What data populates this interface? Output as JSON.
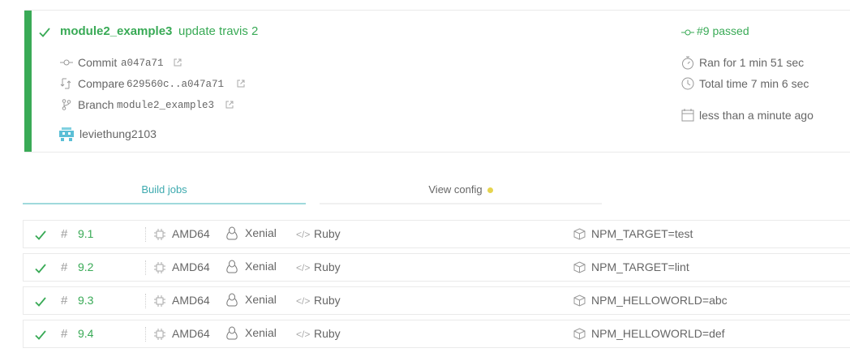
{
  "build": {
    "branch_name": "module2_example3",
    "commit_message": "update travis 2",
    "commit_label": "Commit",
    "commit_hash": "a047a71",
    "compare_label": "Compare",
    "compare_range": "629560c..a047a71",
    "branch_label": "Branch",
    "branch_value": "module2_example3",
    "author": "leviethung2103",
    "status": "#9 passed",
    "ran_for": "Ran for 1 min 51 sec",
    "total_time": "Total time 7 min 6 sec",
    "finished": "less than a minute ago",
    "accent_color": "#39aa56"
  },
  "tabs": {
    "build_jobs": "Build jobs",
    "view_config": "View config"
  },
  "jobs": [
    {
      "number": "9.1",
      "arch": "AMD64",
      "os": "Xenial",
      "language": "Ruby",
      "env": "NPM_TARGET=test"
    },
    {
      "number": "9.2",
      "arch": "AMD64",
      "os": "Xenial",
      "language": "Ruby",
      "env": "NPM_TARGET=lint"
    },
    {
      "number": "9.3",
      "arch": "AMD64",
      "os": "Xenial",
      "language": "Ruby",
      "env": "NPM_HELLOWORLD=abc"
    },
    {
      "number": "9.4",
      "arch": "AMD64",
      "os": "Xenial",
      "language": "Ruby",
      "env": "NPM_HELLOWORLD=def"
    }
  ],
  "icons": {
    "status": "check-icon",
    "commit": "commit-icon",
    "compare": "compare-icon",
    "branch": "branch-icon",
    "external": "external-link-icon",
    "stopwatch": "stopwatch-icon",
    "clock": "clock-icon",
    "calendar": "calendar-icon",
    "job_number": "hash-icon",
    "arch": "cpu-icon",
    "os": "linux-icon",
    "language": "code-icon",
    "env": "package-icon"
  }
}
